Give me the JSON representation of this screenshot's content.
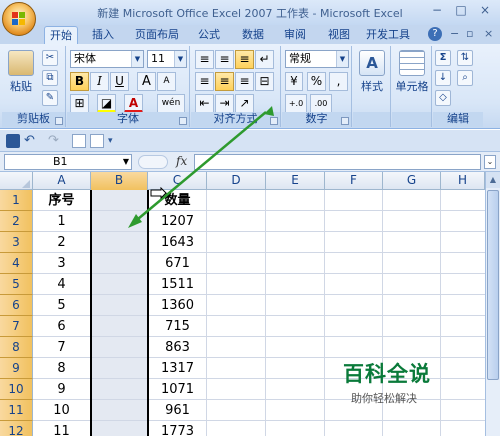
{
  "window": {
    "title": "新建 Microsoft Office Excel 2007 工作表 - Microsoft Excel",
    "controls": [
      "−",
      "□",
      "×"
    ]
  },
  "tabs": [
    "开始",
    "插入",
    "页面布局",
    "公式",
    "数据",
    "审阅",
    "视图",
    "开发工具"
  ],
  "ribbon": {
    "clipboard": {
      "paste": "粘贴",
      "label": "剪贴板"
    },
    "font": {
      "name": "宋体",
      "size": "11",
      "bold": "B",
      "italic": "I",
      "underline": "U",
      "grow": "A",
      "shrink": "A",
      "color_a": "A",
      "phonetic": "wén",
      "label": "字体"
    },
    "alignment": {
      "label": "对齐方式"
    },
    "number": {
      "format": "常规",
      "percent": "%",
      "comma": ",",
      "label": "数字"
    },
    "styles": {
      "style": "样式",
      "label": ""
    },
    "cells": {
      "cell": "单元格"
    },
    "editing": {
      "sigma": "Σ",
      "label": "编辑"
    }
  },
  "formula_bar": {
    "name_box": "B1",
    "fx": "fx",
    "value": ""
  },
  "columns": [
    "A",
    "B",
    "C",
    "D",
    "E",
    "F",
    "G",
    "H"
  ],
  "selected_column": "B",
  "rows": [
    {
      "num": "1",
      "a": "序号",
      "c": "数量"
    },
    {
      "num": "2",
      "a": "1",
      "c": "1207"
    },
    {
      "num": "3",
      "a": "2",
      "c": "1643"
    },
    {
      "num": "4",
      "a": "3",
      "c": "671"
    },
    {
      "num": "5",
      "a": "4",
      "c": "1511"
    },
    {
      "num": "6",
      "a": "5",
      "c": "1360"
    },
    {
      "num": "7",
      "a": "6",
      "c": "715"
    },
    {
      "num": "8",
      "a": "7",
      "c": "863"
    },
    {
      "num": "9",
      "a": "8",
      "c": "1317"
    },
    {
      "num": "10",
      "a": "9",
      "c": "1071"
    },
    {
      "num": "11",
      "a": "10",
      "c": "961"
    },
    {
      "num": "12",
      "a": "11",
      "c": "1773"
    }
  ],
  "watermark": {
    "title": "百科全说",
    "subtitle": "助你轻松解决"
  },
  "colors": {
    "accent": "#15428b",
    "selection": "#f1c15f",
    "arrow": "#2e9a2e",
    "watermark": "#0a7a3a"
  }
}
